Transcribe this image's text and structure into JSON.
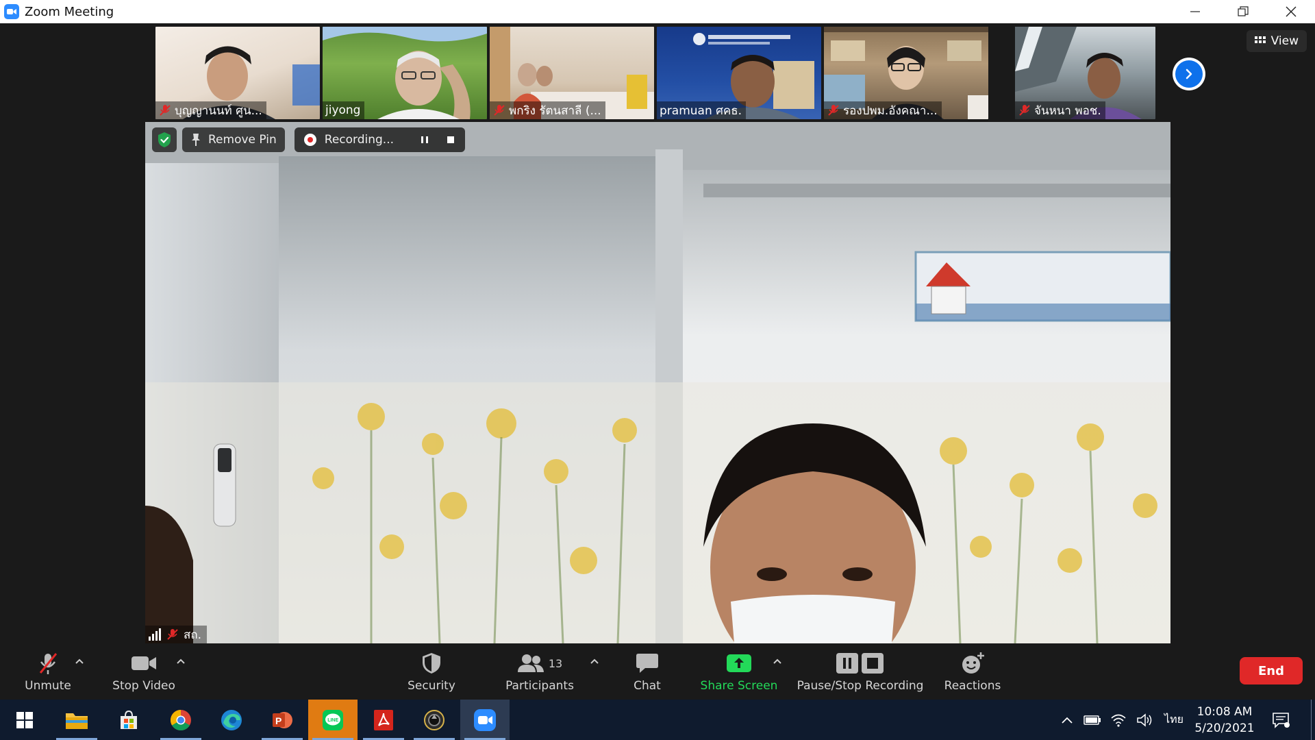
{
  "window": {
    "title": "Zoom Meeting"
  },
  "thumbnails": [
    {
      "name": "บุญญานนท์ ศูน...",
      "muted": true
    },
    {
      "name": "jiyong",
      "muted": false
    },
    {
      "name": "พกริง รัตนสาลี (...",
      "muted": true
    },
    {
      "name": "pramuan ศคธ.",
      "muted": false
    },
    {
      "name": "รองปพม.อังคณา...",
      "muted": true
    },
    {
      "name": "จันหนา พอช.",
      "muted": true
    }
  ],
  "view_label": "View",
  "main_video": {
    "remove_pin_label": "Remove Pin",
    "recording_label": "Recording...",
    "speaker_name": "สถ."
  },
  "toolbar": {
    "unmute": "Unmute",
    "stop_video": "Stop Video",
    "security": "Security",
    "participants": "Participants",
    "participants_count": "13",
    "chat": "Chat",
    "share_screen": "Share Screen",
    "pause_stop_recording": "Pause/Stop Recording",
    "reactions": "Reactions",
    "end": "End"
  },
  "taskbar": {
    "apps": [
      "windows-start",
      "file-explorer",
      "microsoft-store",
      "chrome",
      "edge",
      "powerpoint",
      "line",
      "acrobat",
      "camera-app",
      "zoom"
    ],
    "language": "ไทย",
    "time": "10:08 AM",
    "date": "5/20/2021"
  },
  "colors": {
    "accent_blue": "#0e71eb",
    "share_green": "#23d959",
    "end_red": "#e02828",
    "muted_red": "#e02828"
  }
}
